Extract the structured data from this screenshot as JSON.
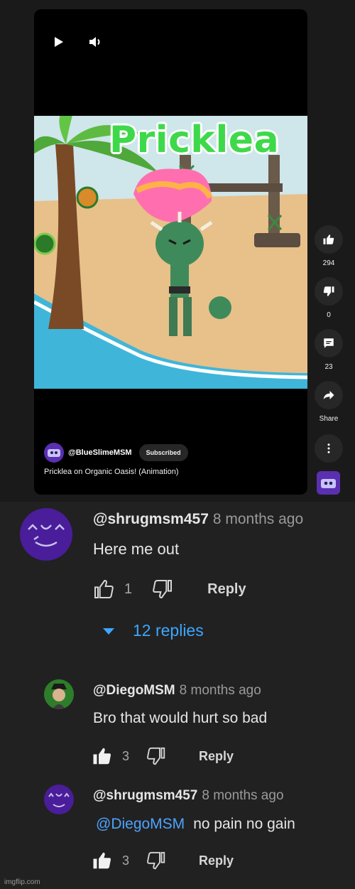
{
  "player": {
    "icons": {
      "play": "play-icon",
      "volume": "volume-icon"
    },
    "frame_title": "Pricklea"
  },
  "channel": {
    "handle": "@BlueSlimeMSM",
    "subscribe_label": "Subscribed"
  },
  "short_title": "Pricklea on Organic Oasis! (Animation)",
  "actions": {
    "like_count": "294",
    "dislike_count": "0",
    "comment_count": "23",
    "share_label": "Share"
  },
  "comments": [
    {
      "user": "@shrugmsm457",
      "time": "8 months ago",
      "text": "Here me out",
      "likes": "1",
      "reply_label": "Reply",
      "replies_label": "12 replies"
    },
    {
      "user": "@DiegoMSM",
      "time": "8 months ago",
      "text": "Bro that would hurt so bad",
      "likes": "3",
      "reply_label": "Reply"
    },
    {
      "user": "@shrugmsm457",
      "time": "8 months ago",
      "mention": "@DiegoMSM",
      "text": "no pain no gain",
      "likes": "3",
      "reply_label": "Reply"
    }
  ],
  "watermark": "imgflip.com",
  "colors": {
    "background": "#212121",
    "link": "#3ea6ff",
    "title_green": "#3ed94a",
    "avatar_purple": "#4a1d9a"
  }
}
